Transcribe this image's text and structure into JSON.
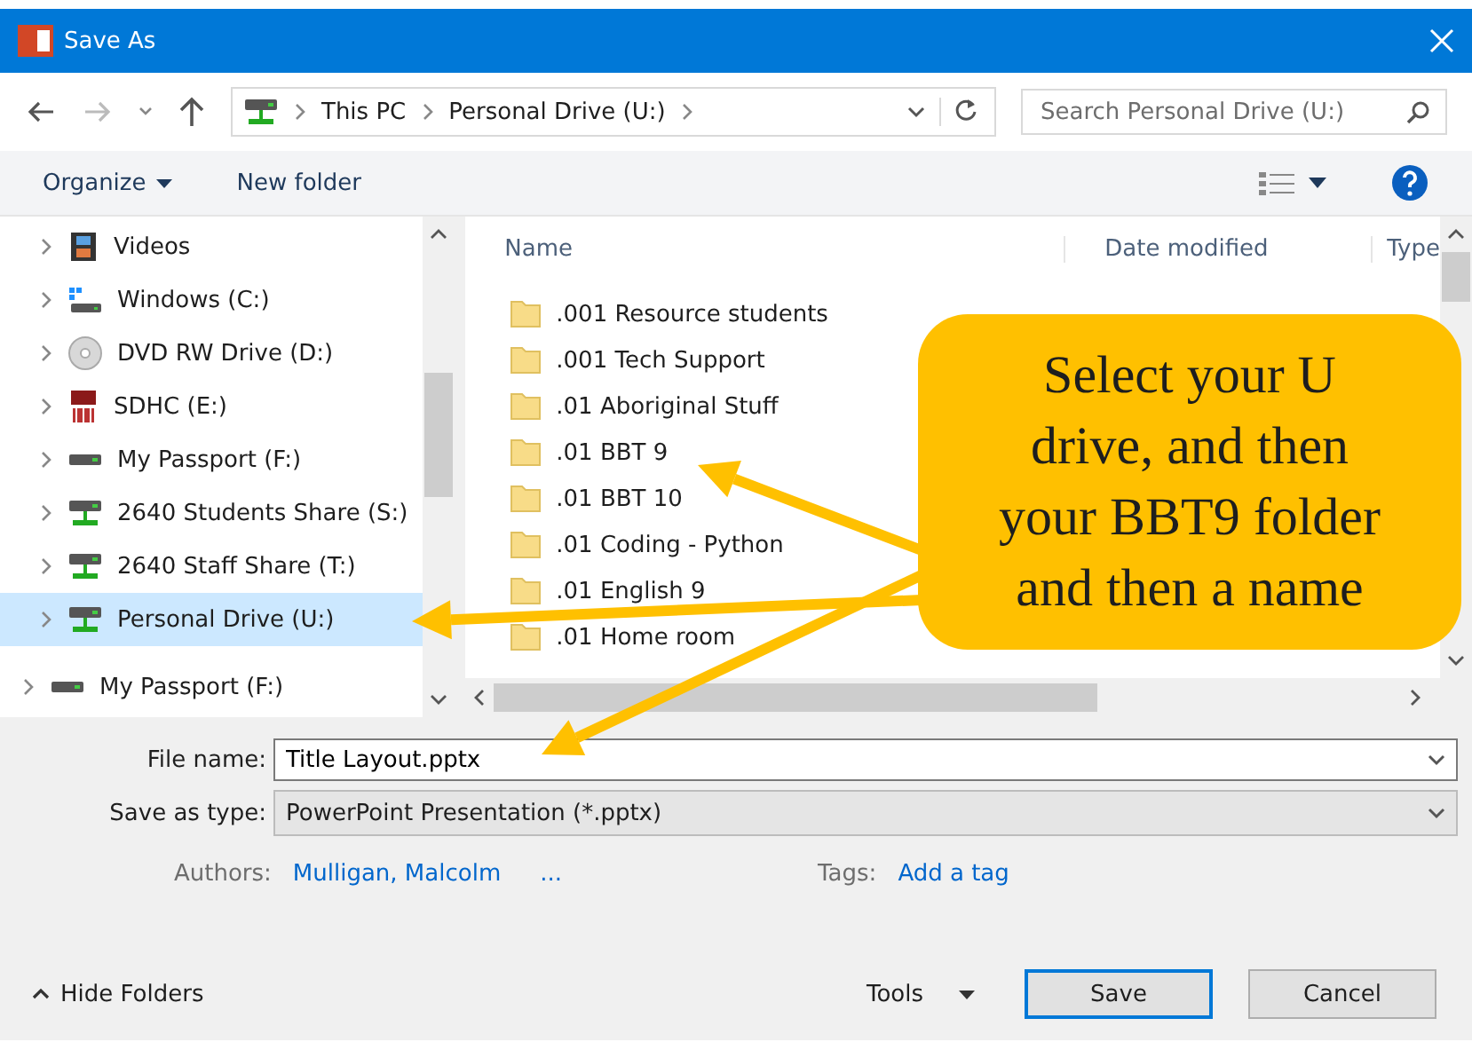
{
  "window": {
    "title": "Save As"
  },
  "breadcrumbs": [
    "This PC",
    "Personal Drive (U:)"
  ],
  "search": {
    "placeholder": "Search Personal Drive (U:)"
  },
  "toolbar": {
    "organize": "Organize",
    "new_folder": "New folder"
  },
  "nav_tree": [
    {
      "children": [
        {
          "label": "Videos",
          "kind": "videos",
          "selected": false
        },
        {
          "label": "Windows (C:)",
          "kind": "windows-drive",
          "selected": false
        },
        {
          "label": "DVD RW Drive (D:)",
          "kind": "disc",
          "selected": false
        },
        {
          "label": "SDHC (E:)",
          "kind": "sd",
          "selected": false
        },
        {
          "label": "My Passport (F:)",
          "kind": "drive",
          "selected": false
        },
        {
          "label": "2640 Students Share (S:)",
          "kind": "network",
          "selected": false
        },
        {
          "label": "2640 Staff Share (T:)",
          "kind": "network",
          "selected": false
        },
        {
          "label": "Personal Drive (U:)",
          "kind": "network",
          "selected": true
        }
      ]
    },
    {
      "label": "My Passport (F:)",
      "kind": "drive",
      "selected": false
    }
  ],
  "columns": [
    "Name",
    "Date modified",
    "Type"
  ],
  "files": [
    ".001 Resource students",
    ".001 Tech Support",
    ".01 Aboriginal Stuff",
    ".01 BBT 9",
    ".01 BBT 10",
    ".01 Coding - Python",
    ".01 English 9",
    ".01 Home room"
  ],
  "form": {
    "file_name_label": "File name:",
    "file_name": "Title Layout.pptx",
    "type_label": "Save as type:",
    "type": "PowerPoint Presentation (*.pptx)",
    "authors_label": "Authors:",
    "authors": "Mulligan, Malcolm",
    "authors_more": "...",
    "tags_label": "Tags:",
    "tags": "Add a tag"
  },
  "footer": {
    "hide_folders": "Hide Folders",
    "tools": "Tools",
    "save": "Save",
    "cancel": "Cancel"
  },
  "callout": {
    "text": "Select your U drive, and then your BBT9 folder and then a name"
  }
}
